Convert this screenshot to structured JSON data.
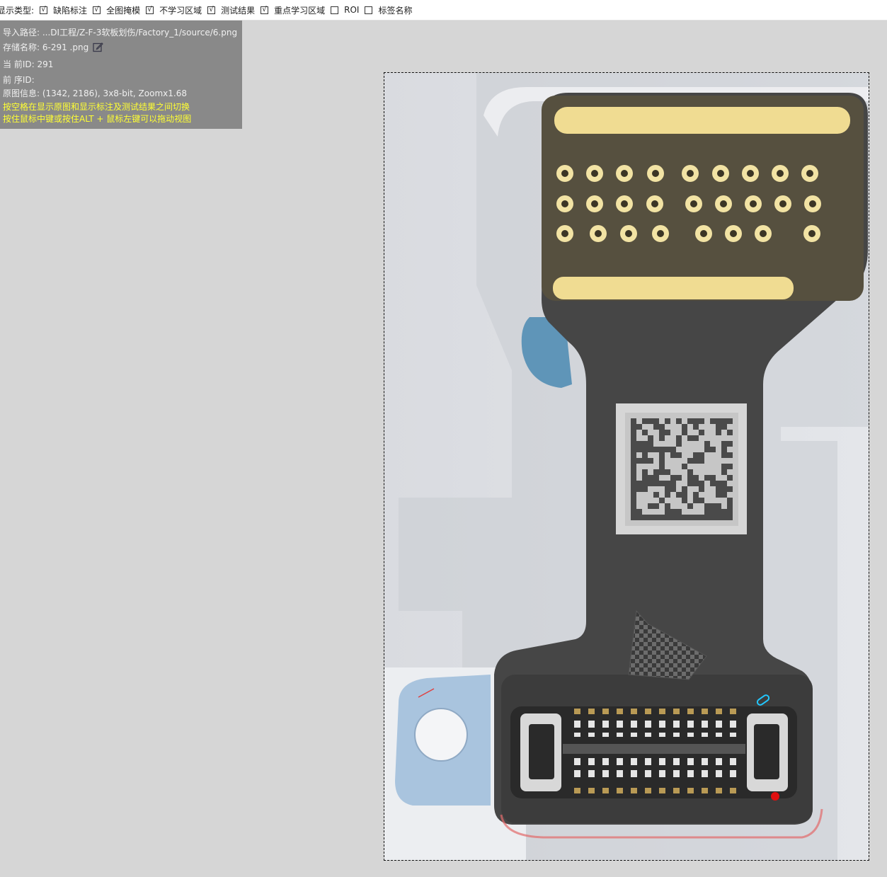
{
  "toolbar": {
    "prefix": "显示类型:",
    "options": [
      {
        "label": "缺陷标注",
        "checked": true
      },
      {
        "label": "全图掩模",
        "checked": true
      },
      {
        "label": "不学习区域",
        "checked": true
      },
      {
        "label": "测试结果",
        "checked": true
      },
      {
        "label": "重点学习区域",
        "checked": true
      },
      {
        "label": "ROI",
        "checked": false
      },
      {
        "label": "标签名称",
        "checked": false
      }
    ]
  },
  "info": {
    "import_path": "导入路径: ...DI工程/Z-F-3软板划伤/Factory_1/source/6.png",
    "save_name": "存储名称: 6-291  .png",
    "current_id": "当 前ID: 291",
    "prev_id": "前 序ID:",
    "image_info": "原图信息: (1342, 2186), 3x8-bit, Zoomx1.68",
    "hint1": "按空格在显示原图和显示标注及测试结果之间切换",
    "hint2": "按住鼠标中键或按住ALT + 鼠标左键可以拖动视图"
  },
  "icons": {
    "edit": "edit-icon"
  },
  "colors": {
    "board_dark": "#464646",
    "gold": "#f0dc92",
    "defect_marker": "#e01010",
    "annotation_cyan": "#22c8ff"
  }
}
